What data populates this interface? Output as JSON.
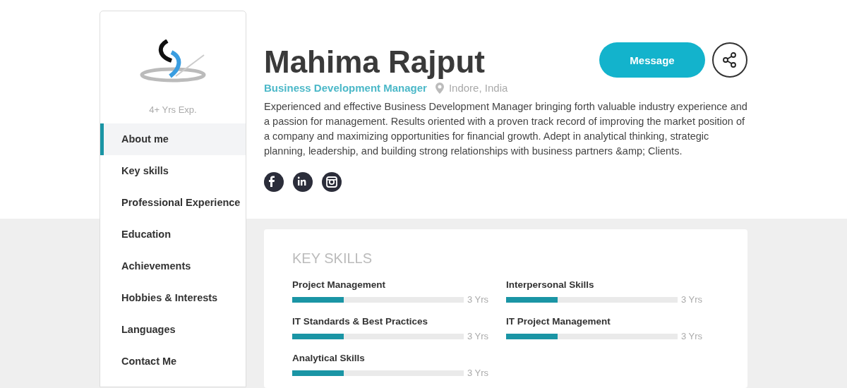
{
  "sidebar": {
    "experience": "4+ Yrs Exp.",
    "items": [
      {
        "label": "About me",
        "selected": true
      },
      {
        "label": "Key skills",
        "selected": false
      },
      {
        "label": "Professional Experience",
        "selected": false
      },
      {
        "label": "Education",
        "selected": false
      },
      {
        "label": "Achievements",
        "selected": false
      },
      {
        "label": "Hobbies & Interests",
        "selected": false
      },
      {
        "label": "Languages",
        "selected": false
      },
      {
        "label": "Contact Me",
        "selected": false
      }
    ]
  },
  "profile": {
    "name": "Mahima Rajput",
    "role": "Business Development Manager",
    "location": "Indore, India",
    "summary": "Experienced and effective Business Development Manager bringing forth valuable industry experience and a passion for management. Results oriented with a proven track record of improving the market position of a company and maximizing opportunities for financial growth. Adept in analytical thinking, strategic planning, leadership, and building strong relationships with business partners &amp; Clients.",
    "message_button": "Message",
    "socials": [
      {
        "kind": "facebook"
      },
      {
        "kind": "linkedin"
      },
      {
        "kind": "instagram"
      }
    ]
  },
  "key_skills": {
    "title": "KEY SKILLS",
    "skills": [
      {
        "name": "Project Management",
        "level": 0.3,
        "reading": "3 Yrs"
      },
      {
        "name": "Interpersonal Skills",
        "level": 0.3,
        "reading": "3 Yrs"
      },
      {
        "name": "IT Standards & Best Practices",
        "level": 0.3,
        "reading": "3 Yrs"
      },
      {
        "name": "IT Project Management",
        "level": 0.3,
        "reading": "3 Yrs"
      },
      {
        "name": "Analytical Skills",
        "level": 0.3,
        "reading": "3 Yrs"
      }
    ]
  }
}
